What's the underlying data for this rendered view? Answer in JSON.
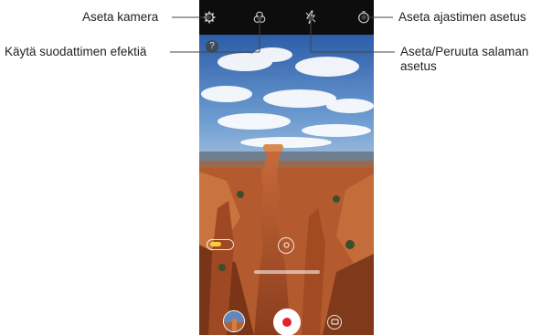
{
  "callouts": {
    "camera_settings": "Aseta kamera",
    "filter_effect": "Käytä suodattimen efektiä",
    "timer_setting": "Aseta ajastimen asetus",
    "flash_setting_line1": "Aseta/Peruuta salaman",
    "flash_setting_line2": "asetus"
  },
  "top_bar": {
    "icons": [
      "gear-icon",
      "filter-icon",
      "flash-icon",
      "timer-icon"
    ]
  },
  "viewfinder": {
    "help_button": "?",
    "icons": [
      "help-icon",
      "shutter-icon",
      "gallery-thumbnail",
      "switch-camera-icon",
      "lens-icon"
    ]
  },
  "colors": {
    "callout_line": "#444444",
    "shutter_dot": "#e0262b",
    "topbar": "#0d0d0d"
  }
}
